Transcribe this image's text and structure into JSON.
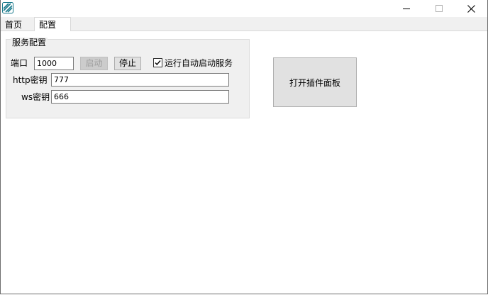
{
  "window": {
    "icon": "app-stripes-icon",
    "controls": {
      "minimize": "minimize-icon",
      "maximize": "maximize-icon",
      "close": "close-icon"
    }
  },
  "tabs": [
    {
      "label": "首页",
      "active": false
    },
    {
      "label": "配置",
      "active": true
    }
  ],
  "service_config": {
    "group_title": "服务配置",
    "port_label": "端口",
    "port_value": "1000",
    "start_label": "启动",
    "start_disabled": true,
    "stop_label": "停止",
    "autostart_label": "运行自动启动服务",
    "autostart_checked": true,
    "http_key_label": "http密钥",
    "http_key_value": "777",
    "ws_key_label": "ws密钥",
    "ws_key_value": "666"
  },
  "plugin_panel_button": "打开插件面板",
  "colors": {
    "accent": "#1a7a8c",
    "button_face": "#e1e1e1",
    "panel": "#f0f0f0"
  }
}
